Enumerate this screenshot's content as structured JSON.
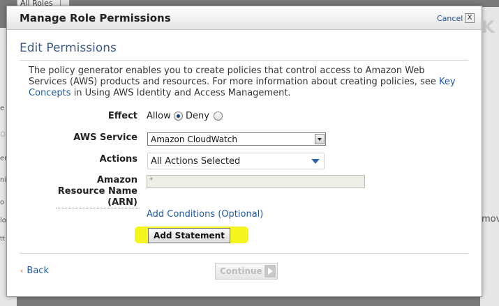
{
  "background": {
    "top_select_value": "All Roles",
    "left_fragments": [
      "e",
      "o",
      "er",
      "nis",
      "o",
      "lo",
      "tt"
    ],
    "right_fragment": "move"
  },
  "modal": {
    "title": "Manage Role Permissions",
    "cancel_label": "Cancel",
    "close_glyph": "X",
    "section_title": "Edit Permissions",
    "intro": {
      "text_before_link": "The policy generator enables you to create policies that control access to Amazon Web Services (AWS) products and resources. For more information about creating policies, see",
      "link_text": "Key Concepts",
      "text_after_link": "in Using AWS Identity and Access Management."
    },
    "form": {
      "effect_label": "Effect",
      "effect_options": [
        {
          "label": "Allow",
          "selected": true
        },
        {
          "label": "Deny",
          "selected": false
        }
      ],
      "service_label": "AWS Service",
      "service_value": "Amazon CloudWatch",
      "actions_label": "Actions",
      "actions_value": "All Actions Selected",
      "arn_label_lines": [
        "Amazon",
        "Resource Name",
        "(ARN)"
      ],
      "arn_value": "*",
      "add_conditions_label": "Add Conditions (Optional)",
      "add_statement_label": "Add Statement"
    },
    "footer": {
      "back_chevron": "‹",
      "back_label": "Back",
      "continue_label": "Continue"
    }
  },
  "colors": {
    "highlight": "#f5f51c",
    "link": "#1f5aa0",
    "section_title": "#3d5c83"
  }
}
